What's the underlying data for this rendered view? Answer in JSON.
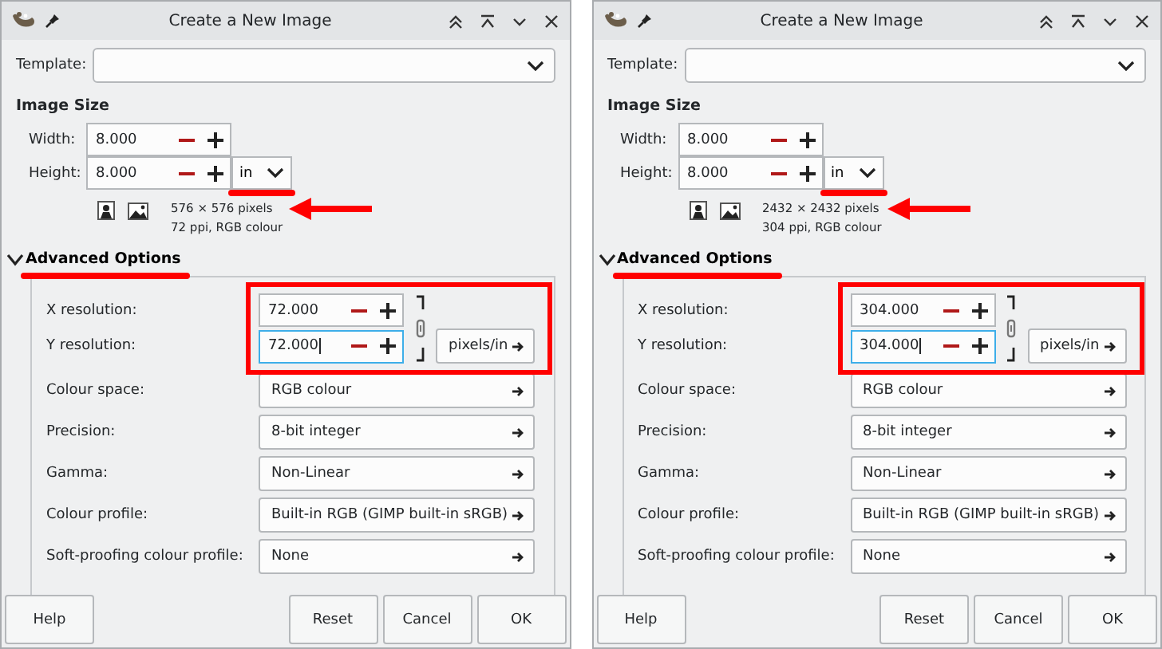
{
  "dialogs": [
    {
      "title": "Create a New Image",
      "template": {
        "label": "Template:"
      },
      "image_size": {
        "heading": "Image Size",
        "width": {
          "label": "Width:",
          "value": "8.000"
        },
        "height": {
          "label": "Height:",
          "value": "8.000"
        },
        "unit": "in",
        "info": [
          "576 × 576 pixels",
          "72 ppi, RGB colour"
        ]
      },
      "advanced": {
        "label": "Advanced Options",
        "expanded": true,
        "x_resolution": {
          "label": "X resolution:",
          "value": "72.000",
          "focused": false
        },
        "y_resolution": {
          "label": "Y resolution:",
          "value": "72.000",
          "focused": true
        },
        "resolution_unit": "pixels/in",
        "rows": [
          {
            "label": "Colour space:",
            "value": "RGB colour"
          },
          {
            "label": "Precision:",
            "value": "8-bit integer"
          },
          {
            "label": "Gamma:",
            "value": "Non-Linear"
          },
          {
            "label": "Colour profile:",
            "value": "Built-in RGB (GIMP built-in sRGB)"
          },
          {
            "label": "Soft-proofing colour profile:",
            "value": "None"
          }
        ]
      },
      "buttons": [
        {
          "label": "Help",
          "kind": "left"
        },
        {
          "label": "Reset",
          "kind": "right"
        },
        {
          "label": "Cancel",
          "kind": "right"
        },
        {
          "label": "OK",
          "kind": "right"
        }
      ],
      "annotations": [
        {
          "kind": "unit-underline"
        },
        {
          "kind": "size-arrow"
        },
        {
          "kind": "section-underline"
        },
        {
          "kind": "resolution-frame"
        }
      ]
    },
    {
      "title": "Create a New Image",
      "template": {
        "label": "Template:"
      },
      "image_size": {
        "heading": "Image Size",
        "width": {
          "label": "Width:",
          "value": "8.000"
        },
        "height": {
          "label": "Height:",
          "value": "8.000"
        },
        "unit": "in",
        "info": [
          "2432 × 2432 pixels",
          "304 ppi, RGB colour"
        ]
      },
      "advanced": {
        "label": "Advanced Options",
        "expanded": true,
        "x_resolution": {
          "label": "X resolution:",
          "value": "304.000",
          "focused": false
        },
        "y_resolution": {
          "label": "Y resolution:",
          "value": "304.000",
          "focused": true
        },
        "resolution_unit": "pixels/in",
        "rows": [
          {
            "label": "Colour space:",
            "value": "RGB colour"
          },
          {
            "label": "Precision:",
            "value": "8-bit integer"
          },
          {
            "label": "Gamma:",
            "value": "Non-Linear"
          },
          {
            "label": "Colour profile:",
            "value": "Built-in RGB (GIMP built-in sRGB)"
          },
          {
            "label": "Soft-proofing colour profile:",
            "value": "None"
          }
        ]
      },
      "buttons": [
        {
          "label": "Help",
          "kind": "left"
        },
        {
          "label": "Reset",
          "kind": "right"
        },
        {
          "label": "Cancel",
          "kind": "right"
        },
        {
          "label": "OK",
          "kind": "right"
        }
      ],
      "annotations": [
        {
          "kind": "unit-underline"
        },
        {
          "kind": "size-arrow"
        },
        {
          "kind": "section-underline"
        },
        {
          "kind": "resolution-frame"
        }
      ]
    }
  ]
}
